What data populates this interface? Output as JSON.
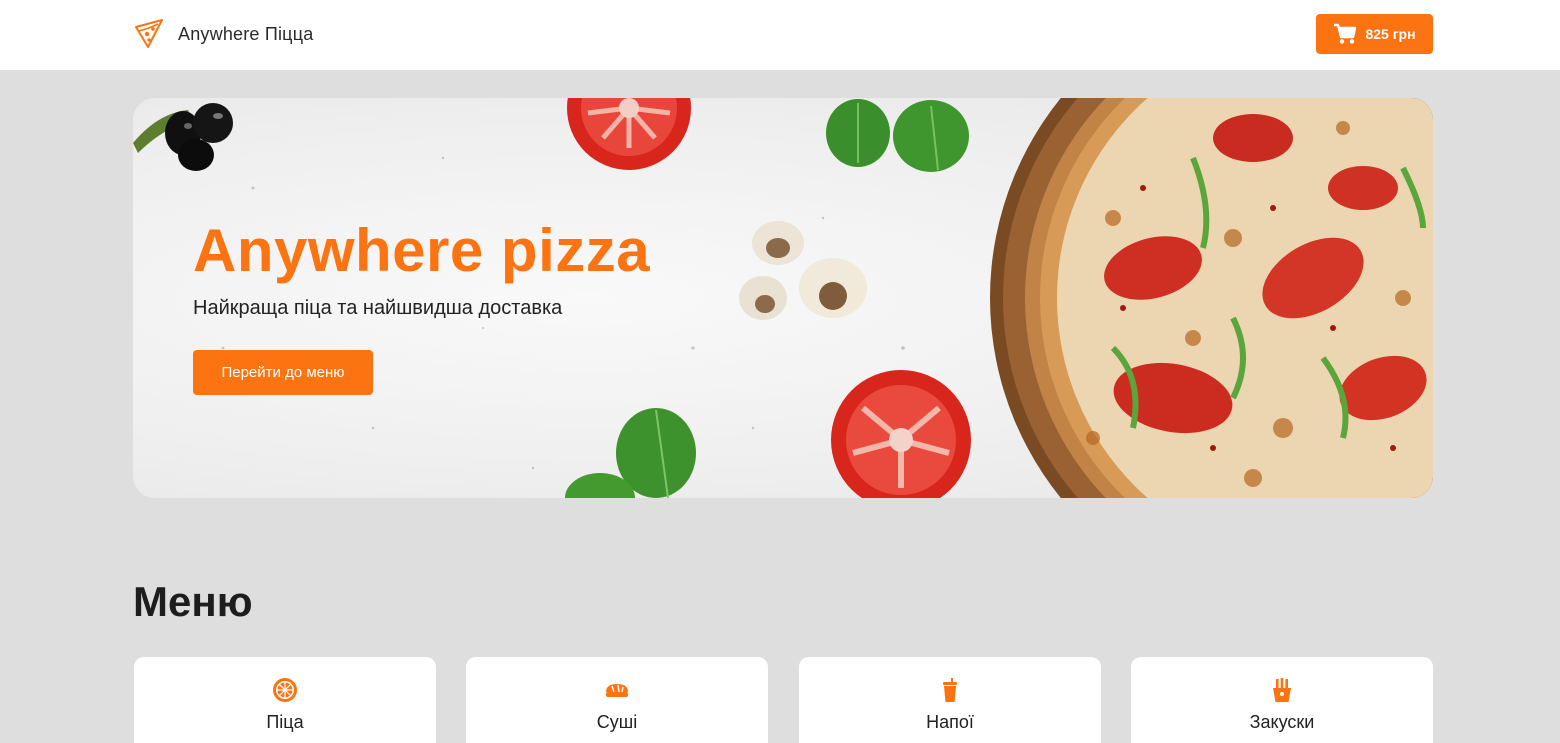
{
  "header": {
    "brand": "Anywhere Піцца",
    "logo_icon": "pizza-slice-icon",
    "cart": {
      "icon": "shopping-cart-icon",
      "total": "825 грн"
    }
  },
  "hero": {
    "title": "Anywhere pizza",
    "subtitle": "Найкраща піца та найшвидша доставка",
    "button_label": "Перейти до меню"
  },
  "menu": {
    "title": "Меню",
    "categories": [
      {
        "label": "Піца",
        "icon": "pizza-icon"
      },
      {
        "label": "Суші",
        "icon": "sushi-icon"
      },
      {
        "label": "Напої",
        "icon": "drink-icon"
      },
      {
        "label": "Закуски",
        "icon": "fries-icon"
      }
    ]
  },
  "colors": {
    "accent": "#fb7411",
    "page_background": "#dedede",
    "header_background": "#ffffff",
    "card_background": "#ffffff"
  }
}
